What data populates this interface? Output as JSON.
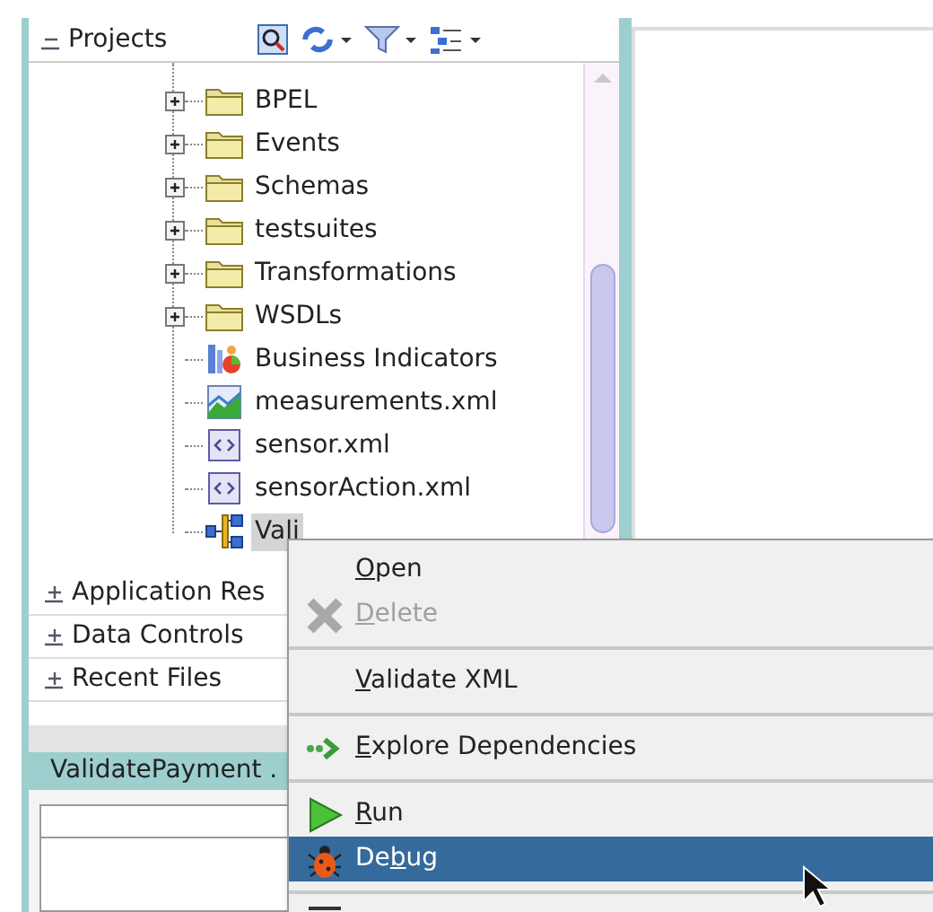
{
  "projects_panel": {
    "title": "Projects",
    "expanded": true
  },
  "tree": [
    {
      "label": "BPEL",
      "kind": "folder",
      "expanded": false,
      "selected": false
    },
    {
      "label": "Events",
      "kind": "folder",
      "expanded": false,
      "selected": false
    },
    {
      "label": "Schemas",
      "kind": "folder",
      "expanded": false,
      "selected": false
    },
    {
      "label": "testsuites",
      "kind": "folder",
      "expanded": false,
      "selected": false
    },
    {
      "label": "Transformations",
      "kind": "folder",
      "expanded": false,
      "selected": false
    },
    {
      "label": "WSDLs",
      "kind": "folder",
      "expanded": false,
      "selected": false
    },
    {
      "label": "Business Indicators",
      "kind": "indicators",
      "selected": false
    },
    {
      "label": "measurements.xml",
      "kind": "measurements",
      "selected": false
    },
    {
      "label": "sensor.xml",
      "kind": "xml",
      "selected": false
    },
    {
      "label": "sensorAction.xml",
      "kind": "xml",
      "selected": false
    },
    {
      "label": "Vali",
      "kind": "composite",
      "selected": true
    }
  ],
  "accordion": [
    {
      "label": "Application Res",
      "expanded": false
    },
    {
      "label": "Data Controls",
      "expanded": false
    },
    {
      "label": "Recent Files",
      "expanded": false
    }
  ],
  "editor_tab": {
    "label": "ValidatePayment ."
  },
  "context_menu": [
    {
      "kind": "item",
      "label": [
        {
          "text": "O",
          "underline": true
        },
        {
          "text": "pen",
          "underline": false
        }
      ],
      "disabled": false,
      "selected": false
    },
    {
      "kind": "item",
      "label": [
        {
          "text": "D",
          "underline": true
        },
        {
          "text": "elete",
          "underline": false
        }
      ],
      "disabled": true,
      "selected": false
    },
    {
      "kind": "separator"
    },
    {
      "kind": "item",
      "label": [
        {
          "text": "V",
          "underline": true
        },
        {
          "text": "alidate XML",
          "underline": false
        }
      ],
      "disabled": false,
      "selected": false
    },
    {
      "kind": "separator"
    },
    {
      "kind": "item",
      "label": [
        {
          "text": "E",
          "underline": true
        },
        {
          "text": "xplore Dependencies",
          "underline": false
        }
      ],
      "disabled": false,
      "selected": false
    },
    {
      "kind": "separator"
    },
    {
      "kind": "item",
      "label": [
        {
          "text": "R",
          "underline": true
        },
        {
          "text": "un",
          "underline": false
        }
      ],
      "disabled": false,
      "selected": false
    },
    {
      "kind": "item",
      "label": [
        {
          "text": "De",
          "underline": false
        },
        {
          "text": "b",
          "underline": true
        },
        {
          "text": "ug",
          "underline": false
        }
      ],
      "disabled": false,
      "selected": true
    },
    {
      "kind": "separator"
    }
  ]
}
